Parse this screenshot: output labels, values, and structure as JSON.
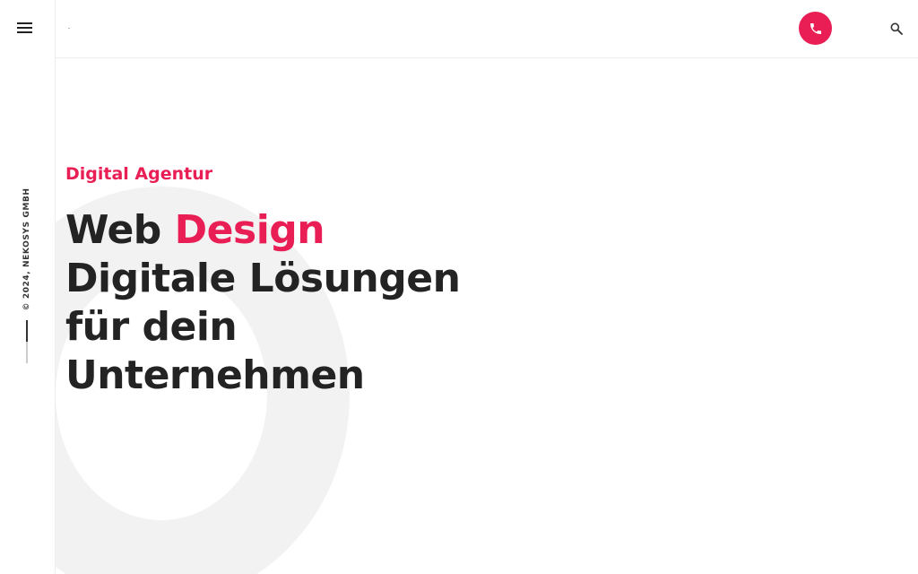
{
  "sidebar": {
    "menu_icon": "hamburger-menu-icon",
    "copyright": "© 2024, NEKOSYS GMBH"
  },
  "header": {
    "phone_icon": "phone-icon",
    "search_icon": "search-icon"
  },
  "hero": {
    "eyebrow": "Digital Agentur",
    "headline_word1": "Web",
    "headline_accent": "Design",
    "headline_line2": "Digitale Lösungen",
    "headline_line3": "für dein",
    "headline_line4": "Unternehmen"
  },
  "colors": {
    "accent": "#e91e55",
    "text": "#232323",
    "ring": "#f2f2f2"
  }
}
